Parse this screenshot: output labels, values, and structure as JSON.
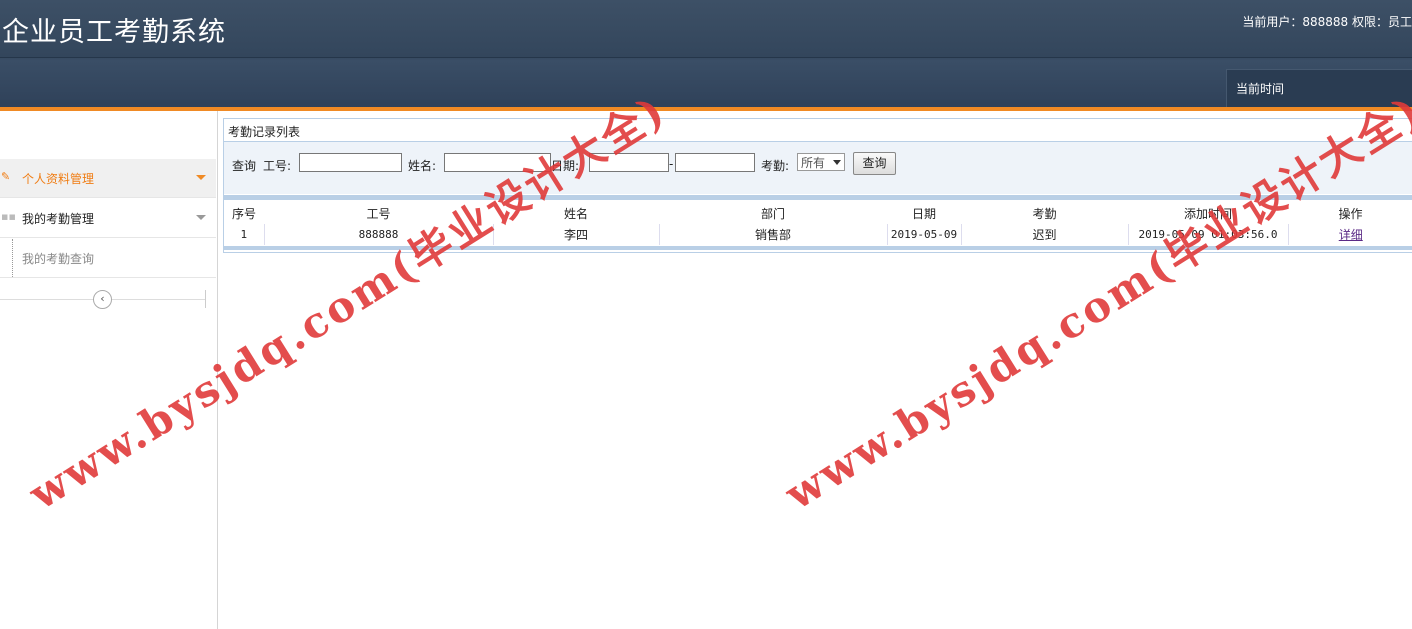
{
  "app": {
    "title": "企业员工考勤系统"
  },
  "header": {
    "user_info": "当前用户：888888 权限：员工",
    "time_label": "当前时间"
  },
  "sidebar": {
    "items": [
      {
        "label": "个人资料管理"
      },
      {
        "label": "我的考勤管理"
      }
    ],
    "sub_items": [
      {
        "label": "我的考勤查询"
      }
    ]
  },
  "panel": {
    "title": "考勤记录列表"
  },
  "search": {
    "query_label": "查询",
    "emp_id_label": "工号:",
    "name_label": "姓名:",
    "date_label": "日期:",
    "date_sep": "-",
    "attendance_label": "考勤:",
    "attendance_selected": "所有",
    "button_label": "查询"
  },
  "table": {
    "headers": [
      "序号",
      "工号",
      "姓名",
      "部门",
      "日期",
      "考勤",
      "添加时间",
      "操作"
    ],
    "rows": [
      [
        "1",
        "888888",
        "李四",
        "销售部",
        "2019-05-09",
        "迟到",
        "2019-05-09 01:03:56.0",
        "详细"
      ]
    ]
  },
  "watermark": {
    "text": "www.bysjdq.com(毕业设计大全)"
  },
  "colors": {
    "header": "#34475d",
    "accent": "#f08a24",
    "panel_border": "#b9cfe6",
    "watermark": "#e03a3a"
  }
}
